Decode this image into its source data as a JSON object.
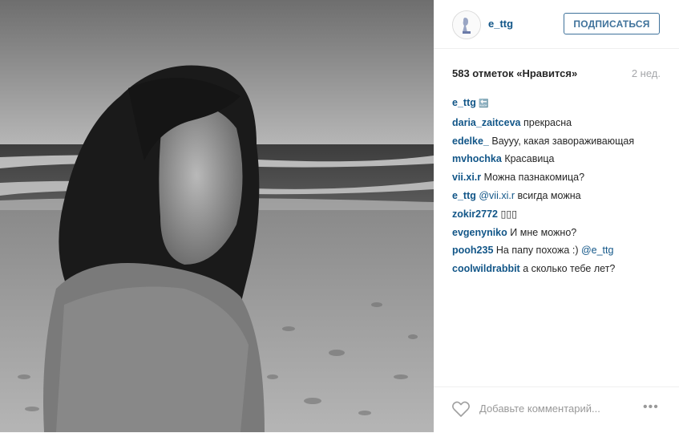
{
  "post": {
    "author": "e_ttg",
    "follow_label": "ПОДПИСАТЬСЯ",
    "likes": "583 отметок «Нравится»",
    "time": "2 нед.",
    "caption": {
      "user": "e_ttg",
      "text": "🔙"
    }
  },
  "comments": [
    {
      "user": "daria_zaitceva",
      "text": "прекрасна"
    },
    {
      "user": "edelke_",
      "text": "Вауyy, какая завораживающая"
    },
    {
      "user": "mvhochka",
      "text": "Красавица"
    },
    {
      "user": "vii.xi.r",
      "text": "Можна пазнакомица?"
    },
    {
      "user": "e_ttg",
      "mention": "@vii.xi.r",
      "text": "всигда можна"
    },
    {
      "user": "zokir2772",
      "text": "▯▯▯"
    },
    {
      "user": "evgenyniko",
      "text": "И мне можно?"
    },
    {
      "user": "pooh235",
      "text": "На папу похожа :)",
      "mention": "@e_ttg"
    },
    {
      "user": "coolwildrabbit",
      "text": "а сколько тебе лет?"
    }
  ],
  "footer": {
    "comment_placeholder": "Добавьте комментарий...",
    "more_label": "•••",
    "heart_icon": "heart-outline-icon"
  }
}
